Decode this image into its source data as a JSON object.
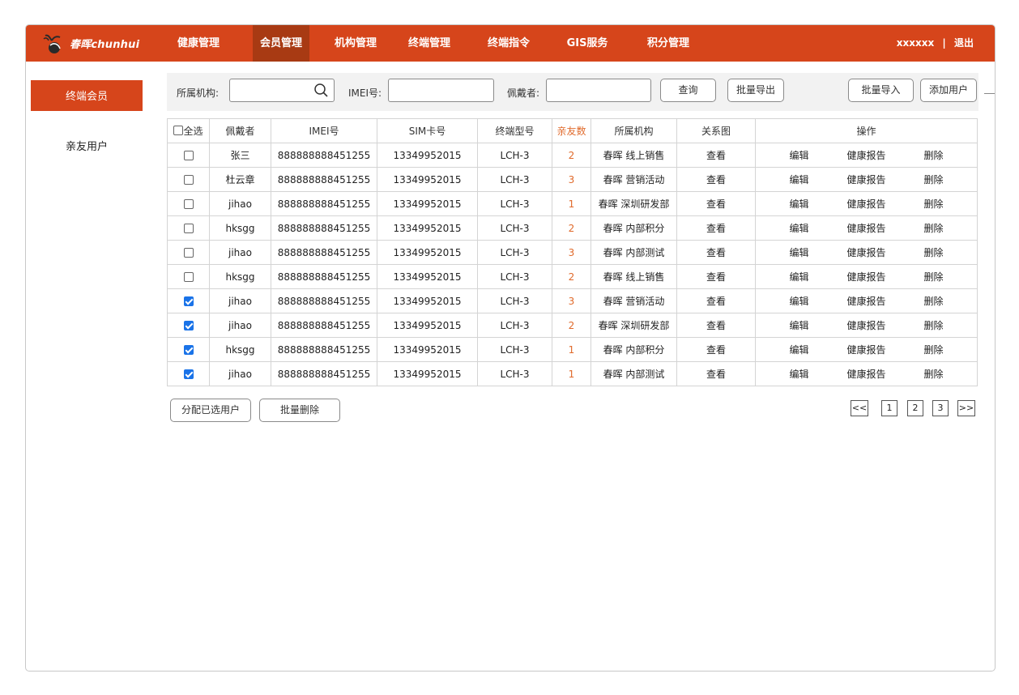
{
  "header": {
    "logo_text": "春晖chunhui",
    "nav": [
      {
        "label": "健康管理"
      },
      {
        "label": "会员管理"
      },
      {
        "label": "机构管理"
      },
      {
        "label": "终端管理"
      },
      {
        "label": "终端指令"
      },
      {
        "label": "GIS服务"
      },
      {
        "label": "积分管理"
      }
    ],
    "active_nav": "会员管理",
    "user": "xxxxxx",
    "separator": "|",
    "logout": "退出"
  },
  "sidebar": {
    "items": [
      {
        "label": "终端会员"
      },
      {
        "label": "亲友用户"
      }
    ],
    "active": "终端会员"
  },
  "toolbar": {
    "org_label": "所属机构:",
    "org_value": "",
    "imei_label": "IMEI号:",
    "imei_value": "",
    "wearer_label": "佩戴者:",
    "wearer_value": "",
    "query": "查询",
    "export": "批量导出",
    "import": "批量导入",
    "add_user": "添加用户"
  },
  "table": {
    "headers": {
      "select_all": "全选",
      "wearer": "佩戴者",
      "imei": "IMEI号",
      "sim": "SIM卡号",
      "model": "终端型号",
      "friends": "亲友数",
      "org": "所属机构",
      "relation": "关系图",
      "ops": "操作"
    },
    "rows": [
      {
        "checked": false,
        "wearer": "张三",
        "imei": "888888888451255",
        "sim": "13349952015",
        "model": "LCH-3",
        "friends": "2",
        "org": "春晖 线上销售",
        "view": "查看",
        "edit": "编辑",
        "report": "健康报告",
        "delete": "删除"
      },
      {
        "checked": false,
        "wearer": "杜云章",
        "imei": "888888888451255",
        "sim": "13349952015",
        "model": "LCH-3",
        "friends": "3",
        "org": "春晖 营销活动",
        "view": "查看",
        "edit": "编辑",
        "report": "健康报告",
        "delete": "删除"
      },
      {
        "checked": false,
        "wearer": "jihao",
        "imei": "888888888451255",
        "sim": "13349952015",
        "model": "LCH-3",
        "friends": "1",
        "org": "春晖 深圳研发部",
        "view": "查看",
        "edit": "编辑",
        "report": "健康报告",
        "delete": "删除"
      },
      {
        "checked": false,
        "wearer": "hksgg",
        "imei": "888888888451255",
        "sim": "13349952015",
        "model": "LCH-3",
        "friends": "2",
        "org": "春晖 内部积分",
        "view": "查看",
        "edit": "编辑",
        "report": "健康报告",
        "delete": "删除"
      },
      {
        "checked": false,
        "wearer": "jihao",
        "imei": "888888888451255",
        "sim": "13349952015",
        "model": "LCH-3",
        "friends": "3",
        "org": "春晖 内部测试",
        "view": "查看",
        "edit": "编辑",
        "report": "健康报告",
        "delete": "删除"
      },
      {
        "checked": false,
        "wearer": "hksgg",
        "imei": "888888888451255",
        "sim": "13349952015",
        "model": "LCH-3",
        "friends": "2",
        "org": "春晖 线上销售",
        "view": "查看",
        "edit": "编辑",
        "report": "健康报告",
        "delete": "删除"
      },
      {
        "checked": true,
        "wearer": "jihao",
        "imei": "888888888451255",
        "sim": "13349952015",
        "model": "LCH-3",
        "friends": "3",
        "org": "春晖 营销活动",
        "view": "查看",
        "edit": "编辑",
        "report": "健康报告",
        "delete": "删除"
      },
      {
        "checked": true,
        "wearer": "jihao",
        "imei": "888888888451255",
        "sim": "13349952015",
        "model": "LCH-3",
        "friends": "2",
        "org": "春晖 深圳研发部",
        "view": "查看",
        "edit": "编辑",
        "report": "健康报告",
        "delete": "删除"
      },
      {
        "checked": true,
        "wearer": "hksgg",
        "imei": "888888888451255",
        "sim": "13349952015",
        "model": "LCH-3",
        "friends": "1",
        "org": "春晖 内部积分",
        "view": "查看",
        "edit": "编辑",
        "report": "健康报告",
        "delete": "删除"
      },
      {
        "checked": true,
        "wearer": "jihao",
        "imei": "888888888451255",
        "sim": "13349952015",
        "model": "LCH-3",
        "friends": "1",
        "org": "春晖 内部测试",
        "view": "查看",
        "edit": "编辑",
        "report": "健康报告",
        "delete": "删除"
      }
    ]
  },
  "bottom": {
    "assign": "分配已选用户",
    "batch_delete": "批量删除"
  },
  "pagination": {
    "prev": "<<",
    "pages": [
      "1",
      "2",
      "3"
    ],
    "next": ">>"
  },
  "colors": {
    "brand": "#d6451b",
    "active_nav": "#a83a13",
    "friends_count": "#e06a2b",
    "checkbox_checked": "#1a73e8"
  }
}
